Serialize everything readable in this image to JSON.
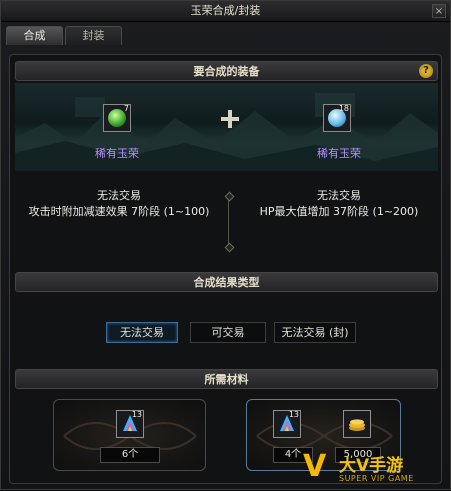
{
  "window": {
    "title": "玉荣合成/封装",
    "close_label": "×"
  },
  "tabs": [
    {
      "label": "合成",
      "active": true
    },
    {
      "label": "封装",
      "active": false
    }
  ],
  "required_equipment": {
    "header": "要合成的装备",
    "help_label": "?",
    "plus_icon": "cross-plus-icon",
    "left": {
      "name": "稀有玉荣",
      "count": "7",
      "icon": "green-jade-icon",
      "color": "#b790ff",
      "desc_line1": "无法交易",
      "desc_line2": "攻击时附加减速效果 7阶段 (1~100)"
    },
    "right": {
      "name": "稀有玉荣",
      "count": "18",
      "icon": "blue-jade-icon",
      "color": "#b790ff",
      "desc_line1": "无法交易",
      "desc_line2": "HP最大值增加 37阶段 (1~200)"
    }
  },
  "result_type": {
    "header": "合成结果类型",
    "options": [
      {
        "label": "无法交易",
        "selected": true
      },
      {
        "label": "可交易",
        "selected": false
      },
      {
        "label": "无法交易 (封)",
        "selected": false
      }
    ]
  },
  "materials": {
    "header": "所需材料",
    "left": {
      "item_count": "13",
      "icon": "rainbow-crystal-icon",
      "quantity": "6个"
    },
    "right": {
      "item_count": "13",
      "icon": "rainbow-crystal-icon",
      "quantity": "4个",
      "gold_icon": "gold-coins-icon",
      "gold_amount": "5,000"
    }
  },
  "watermark": {
    "brand": "大V手游",
    "sub": "SUPER VIP GAME"
  }
}
